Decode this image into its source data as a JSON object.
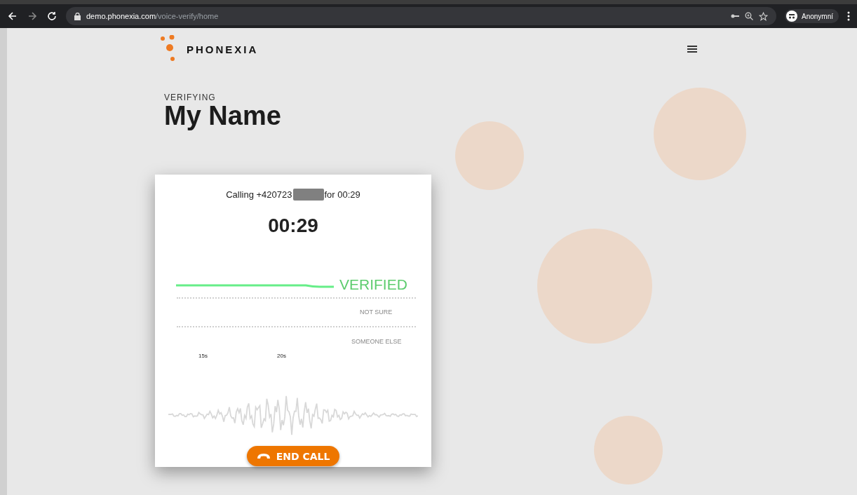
{
  "browser": {
    "url_host": "demo.phonexia.com",
    "url_path": "/voice-verify/home",
    "profile": "Anonymní"
  },
  "header": {
    "logo": "PHONEXIA"
  },
  "title": {
    "eyebrow": "VERIFYING",
    "name": "My Name"
  },
  "call": {
    "calling_prefix": "Calling +420723",
    "calling_suffix": "for 00:29",
    "timer": "00:29",
    "result": "VERIFIED",
    "levels": [
      "NOT SURE",
      "SOMEONE ELSE"
    ],
    "ticks": [
      "15s",
      "20s"
    ],
    "end_button": "END CALL"
  }
}
